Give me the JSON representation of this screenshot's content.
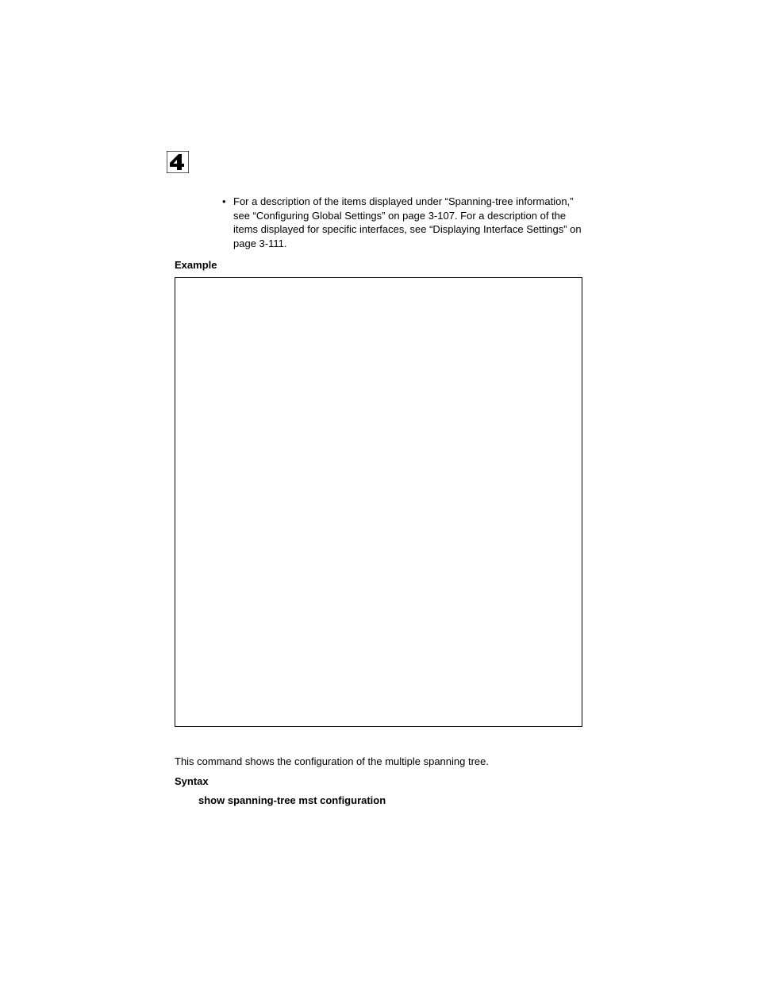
{
  "chapter_number": "4",
  "bullet_text": "For a description of the items displayed under “Spanning-tree information,” see “Configuring Global Settings” on page 3-107. For a description of the items displayed for specific interfaces, see “Displaying Interface Settings” on page 3-111.",
  "labels": {
    "example": "Example",
    "syntax": "Syntax"
  },
  "description": "This command shows the configuration of the multiple spanning tree.",
  "syntax_command": "show spanning-tree mst configuration"
}
